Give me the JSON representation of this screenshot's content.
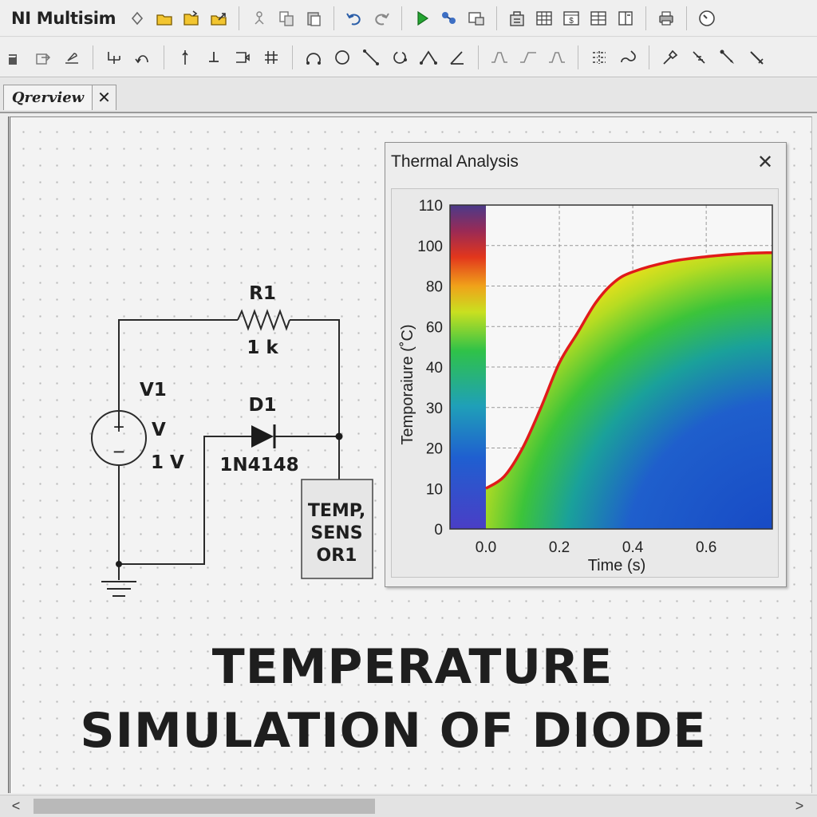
{
  "app": {
    "name": "NI Multisim"
  },
  "toolbar_main": [
    {
      "name": "component-diamond-icon"
    },
    {
      "name": "new-file-icon"
    },
    {
      "name": "open-file-icon"
    },
    {
      "name": "save-file-icon"
    },
    {
      "sep": true
    },
    {
      "name": "place-component-icon"
    },
    {
      "name": "copy-icon"
    },
    {
      "name": "paste-icon"
    },
    {
      "sep": true
    },
    {
      "name": "undo-icon"
    },
    {
      "name": "redo-icon"
    },
    {
      "sep": true
    },
    {
      "name": "run-simulation-icon"
    },
    {
      "name": "simulate-settings-icon"
    },
    {
      "name": "grapher-icon"
    },
    {
      "sep": true
    },
    {
      "name": "component-library-icon"
    },
    {
      "name": "spreadsheet-icon"
    },
    {
      "name": "database-icon"
    },
    {
      "name": "netlist-icon"
    },
    {
      "name": "panel-icon"
    },
    {
      "sep": true
    },
    {
      "name": "print-icon"
    },
    {
      "sep": true
    },
    {
      "name": "gauge-icon"
    }
  ],
  "toolbar_draw": [
    {
      "name": "place-text-icon"
    },
    {
      "name": "export-icon"
    },
    {
      "name": "draw-line-icon"
    },
    {
      "sep": true
    },
    {
      "name": "place-junction-icon"
    },
    {
      "name": "place-arc-icon"
    },
    {
      "sep": true
    },
    {
      "name": "place-node-icon"
    },
    {
      "name": "place-ground-icon"
    },
    {
      "name": "place-arrow-icon"
    },
    {
      "name": "place-bus-icon"
    },
    {
      "sep": true
    },
    {
      "name": "draw-arc-icon"
    },
    {
      "name": "draw-circle-icon"
    },
    {
      "name": "draw-diagonal-icon"
    },
    {
      "name": "draw-rotate-icon"
    },
    {
      "name": "draw-polyline-icon"
    },
    {
      "name": "draw-angle-icon"
    },
    {
      "sep": true
    },
    {
      "name": "trapezoid-icon"
    },
    {
      "name": "ramp-icon"
    },
    {
      "name": "pulse-icon"
    },
    {
      "sep": true
    },
    {
      "name": "bus-entry-icon"
    },
    {
      "name": "hierarchy-icon"
    },
    {
      "sep": true
    },
    {
      "name": "probe-icon"
    },
    {
      "name": "voltage-probe-icon"
    },
    {
      "name": "current-probe-icon"
    },
    {
      "name": "pin-icon"
    }
  ],
  "tabs": {
    "active_label": "Qrerview",
    "close_glyph": "✕"
  },
  "schematic": {
    "r1": {
      "ref": "R1",
      "value": "1 k"
    },
    "v1": {
      "ref": "V1",
      "label": "V",
      "value": "1 V",
      "plus": "+",
      "minus": "−"
    },
    "d1": {
      "ref": "D1",
      "model": "1N4148"
    },
    "sensor": {
      "line1": "TEMP,",
      "line2": "SENS",
      "line3": "OR1"
    }
  },
  "titles": {
    "line1": "TEMPERATURE",
    "line2": "SIMULATION OF DIODE"
  },
  "thermal_window": {
    "title": "Thermal Analysis",
    "close_glyph": "✕"
  },
  "chart_data": {
    "type": "area",
    "title": "",
    "xlabel": "Time (s)",
    "ylabel": "Temporaiure (˚C)",
    "x_ticks": [
      0.0,
      0.2,
      0.4,
      0.6
    ],
    "x_tick_labels": [
      "0.0",
      "0.2",
      "0.4",
      "0.6"
    ],
    "xlim": [
      0.0,
      0.78
    ],
    "y_tick_labels": [
      "0",
      "10",
      "20",
      "30",
      "40",
      "60",
      "80",
      "100",
      "110"
    ],
    "grid": true,
    "colorbar": true,
    "line_color": "#e01a1a",
    "series": [
      {
        "x": [
          0.0,
          0.05,
          0.1,
          0.15,
          0.2,
          0.25,
          0.3,
          0.35,
          0.4,
          0.5,
          0.6,
          0.7,
          0.78
        ],
        "y": [
          10,
          13,
          20,
          30,
          42,
          57,
          72,
          82,
          87,
          92,
          94.5,
          96,
          96.5
        ]
      }
    ]
  }
}
